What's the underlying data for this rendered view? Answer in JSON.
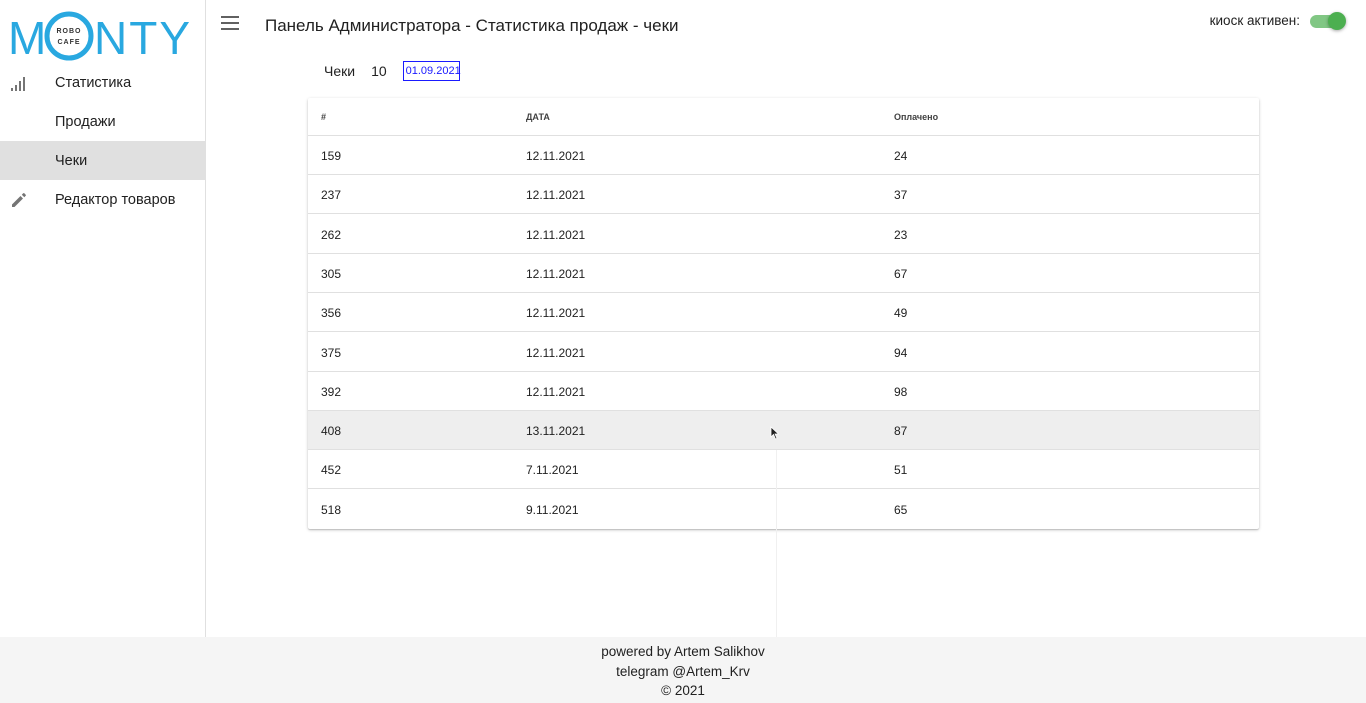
{
  "logo": {
    "text_left": "M",
    "text_right": "NTY",
    "badge_top": "ROBO",
    "badge_bottom": "CAFE",
    "color": "#29a8e0"
  },
  "sidebar": {
    "items": [
      {
        "label": "Статистика",
        "icon": "signal-bars-icon",
        "active": false
      },
      {
        "label": "Продажи",
        "icon": "",
        "active": false
      },
      {
        "label": "Чеки",
        "icon": "",
        "active": true
      },
      {
        "label": "Редактор товаров",
        "icon": "pencil-icon",
        "active": false
      }
    ]
  },
  "header": {
    "title": "Панель Администратора - Статистика продаж - чеки",
    "kiosk_label": "киоск активен:",
    "kiosk_active": true
  },
  "filter": {
    "label": "Чеки",
    "count": "10",
    "date": "01.09.2021"
  },
  "table": {
    "headers": [
      "#",
      "ДАТА",
      "Оплачено"
    ],
    "rows": [
      [
        "159",
        "12.11.2021",
        "24"
      ],
      [
        "237",
        "12.11.2021",
        "37"
      ],
      [
        "262",
        "12.11.2021",
        "23"
      ],
      [
        "305",
        "12.11.2021",
        "67"
      ],
      [
        "356",
        "12.11.2021",
        "49"
      ],
      [
        "375",
        "12.11.2021",
        "94"
      ],
      [
        "392",
        "12.11.2021",
        "98"
      ],
      [
        "408",
        "13.11.2021",
        "87"
      ],
      [
        "452",
        "7.11.2021",
        "51"
      ],
      [
        "518",
        "9.11.2021",
        "65"
      ]
    ]
  },
  "footer": {
    "line1": "powered by Artem Salikhov",
    "line2": "telegram @Artem_Krv",
    "line3": "© 2021"
  },
  "colors": {
    "accent": "#4caf50",
    "active_bg": "#e0e0e0",
    "date_border": "#1a1aff"
  }
}
